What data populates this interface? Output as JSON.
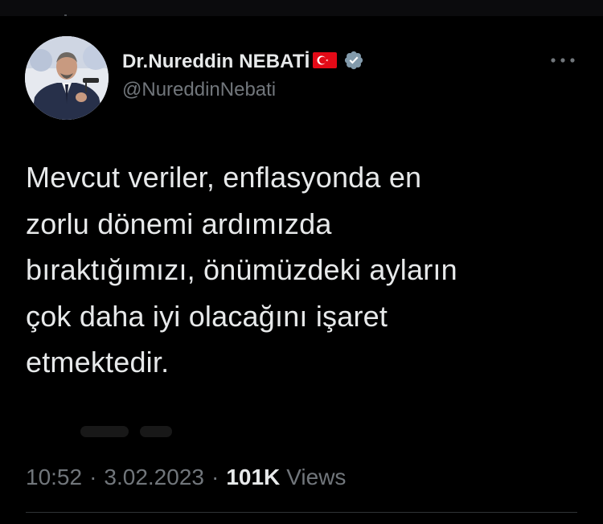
{
  "author": {
    "display_name": "Dr.Nureddin NEBATİ",
    "handle": "@NureddinNebati",
    "flag_icon": "turkey-flag-icon",
    "verified_icon": "verified-badge-icon"
  },
  "tweet": {
    "text": "Mevcut veriler, enflasyonda en\nzorlu dönemi ardımızda\nbıraktığımızı, önümüzdeki ayların\nçok daha iyi olacağını işaret\netmektedir."
  },
  "meta": {
    "time": "10:52",
    "separator": "·",
    "date": "3.02.2023",
    "views_count": "101K",
    "views_label": "Views"
  },
  "icons": {
    "more": "more-options-icon"
  },
  "colors": {
    "background": "#000000",
    "text_primary": "#e7e9ea",
    "text_secondary": "#71767b",
    "divider": "#2f3336",
    "verified": "#829aab",
    "flag_red": "#e30a17"
  }
}
